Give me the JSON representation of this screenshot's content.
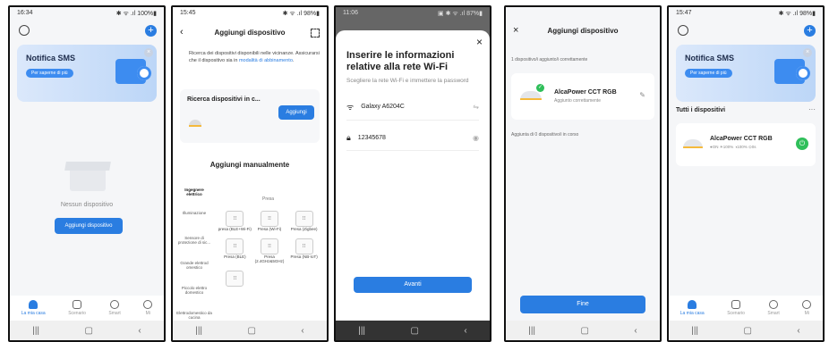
{
  "s1": {
    "time": "16:34",
    "status": "✱ ᯤ .ıl 100%▮",
    "banner_title": "Notifica SMS",
    "banner_btn": "Per saperne di più",
    "empty": "Nessun dispositivo",
    "add_btn": "Aggiungi dispositivo",
    "tabs": [
      "La mia casa",
      "Scenario",
      "Smart",
      "Mi"
    ]
  },
  "s2": {
    "time": "15:45",
    "status": "✱ ᯤ .ıl 98%▮",
    "title": "Aggiungi dispositivo",
    "info1": "Ricerca dei dispositivi disponibili nelle vicinanze.",
    "info2": "Assicurarsi che il dispositivo sia in ",
    "info_link": "modalità di abbinamento",
    "info_end": ".",
    "search_title": "Ricerca dispositivi in c...",
    "search_btn": "Aggiungi",
    "manual_title": "Aggiungi manualmente",
    "cats": [
      "Ingegnere elettrico",
      "Illuminazione",
      "Sensore di protezione di sic...",
      "Grande elettrod omestico",
      "Piccolo elettro domestico",
      "Elettrodomestico da cucina"
    ],
    "col_head": "Presa",
    "items": [
      {
        "label": "presa (BLE+Wi-Fi)"
      },
      {
        "label": "Presa (Wi-Fi)"
      },
      {
        "label": "Presa (Zigbee)"
      },
      {
        "label": "Presa (BLE)"
      },
      {
        "label": "Presa (2.4GHz&5GHz)"
      },
      {
        "label": "Presa (NB-IoT)"
      }
    ]
  },
  "s3": {
    "time": "11:06",
    "status": "▣ ✱ ᯤ .ıl 87%▮",
    "title": "Inserire le informazioni relative alla rete Wi-Fi",
    "subtitle": "Scegliere la rete Wi-Fi e immettere la password",
    "ssid": "Galaxy A6204C",
    "password": "12345678",
    "next": "Avanti"
  },
  "s4": {
    "title": "Aggiungi dispositivo",
    "added": "1 dispositivo/i aggiunto/i correttamente",
    "dev_name": "AlcaPower CCT RGB",
    "dev_status": "Aggiunto correttamente",
    "pending": "Aggiunta di 0 dispositivo/i in corso",
    "done": "Fine"
  },
  "s5": {
    "time": "15:47",
    "status": "✱ ᯤ .ıl 98%▮",
    "banner_title": "Notifica SMS",
    "banner_btn": "Per saperne di più",
    "all": "Tutti i dispositivi",
    "dev_name": "AlcaPower CCT RGB",
    "dev_stats": "●ON ☀100% ◑100% ⊙0s",
    "tabs": [
      "La mia casa",
      "Scenario",
      "Smart",
      "Mi"
    ]
  }
}
